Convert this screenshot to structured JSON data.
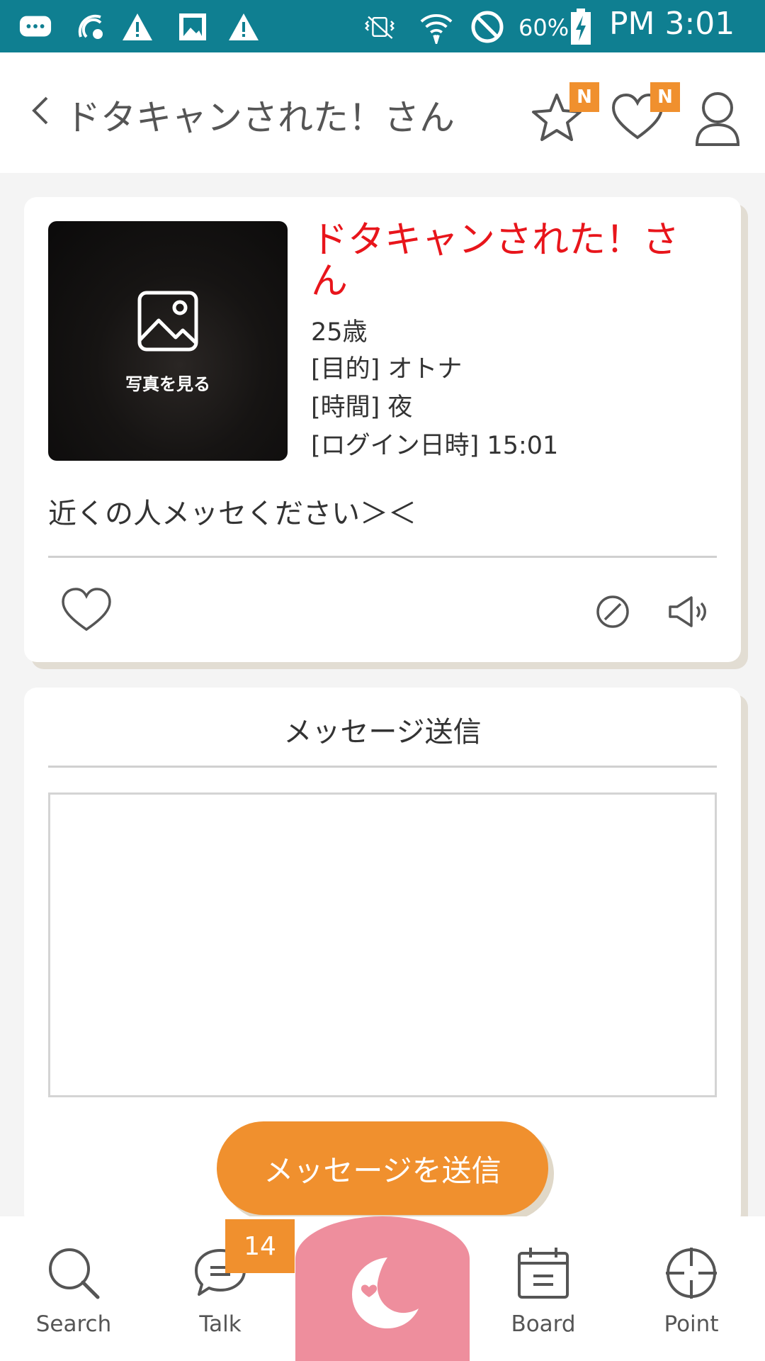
{
  "status_bar": {
    "battery": "60%",
    "time": "PM 3:01",
    "icons": [
      "chat-bubble-icon",
      "hotspot-icon",
      "warning-icon",
      "image-icon",
      "warning-icon",
      "vibrate-mute-icon",
      "wifi-icon",
      "blocked-icon",
      "battery-charging-icon"
    ]
  },
  "header": {
    "back_icon": "‹",
    "title": "ドタキャンされた！さん",
    "star_badge": "N",
    "heart_badge": "N"
  },
  "profile": {
    "photo_label": "写真を見る",
    "name": "ドタキャンされた！さん",
    "age": "25歳",
    "purpose": "[目的] オトナ",
    "time": "[時間] 夜",
    "login": "[ログイン日時] 15:01",
    "message": "近くの人メッセください＞＜"
  },
  "message_form": {
    "title": "メッセージ送信",
    "textarea_value": "",
    "send_label": "メッセージを送信"
  },
  "bottom_nav": {
    "items": [
      {
        "label": "Search",
        "icon": "search-icon"
      },
      {
        "label": "Talk",
        "icon": "chat-icon"
      },
      {
        "label": "",
        "icon": "moon-heart-logo-icon"
      },
      {
        "label": "Board",
        "icon": "board-icon"
      },
      {
        "label": "Point",
        "icon": "crosshair-icon"
      }
    ],
    "talk_badge": "14"
  },
  "colors": {
    "status_bar": "#0f7f91",
    "accent_orange": "#f0902e",
    "name_red": "#e8151b",
    "center_pink": "#ee8e9d"
  }
}
